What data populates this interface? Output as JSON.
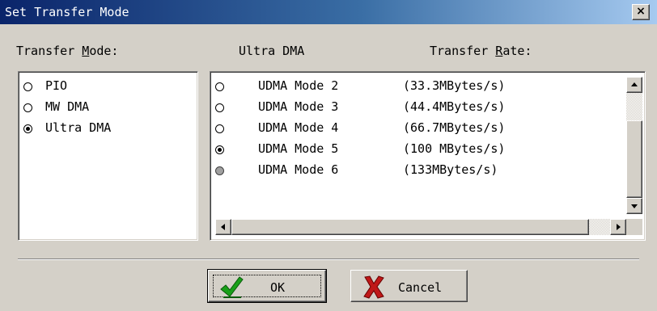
{
  "window": {
    "title": "Set Transfer Mode",
    "close_glyph": "×"
  },
  "labels": {
    "transfer_mode": "Transfer Mode:",
    "transfer_mode_prefix": "Transfer ",
    "transfer_mode_accel": "M",
    "transfer_mode_rest": "ode:",
    "ultra_dma": "Ultra DMA",
    "transfer_rate_prefix": "Transfer ",
    "transfer_rate_accel": "R",
    "transfer_rate_rest": "ate:"
  },
  "transfer_modes": [
    {
      "label": "PIO",
      "selected": false
    },
    {
      "label": "MW DMA",
      "selected": false
    },
    {
      "label": "Ultra DMA",
      "selected": true
    }
  ],
  "udma_modes": [
    {
      "label": "UDMA Mode 2",
      "rate": "(33.3MBytes/s)",
      "selected": false,
      "enabled": true
    },
    {
      "label": "UDMA Mode 3",
      "rate": "(44.4MBytes/s)",
      "selected": false,
      "enabled": true
    },
    {
      "label": "UDMA Mode 4",
      "rate": "(66.7MBytes/s)",
      "selected": false,
      "enabled": true
    },
    {
      "label": "UDMA Mode 5",
      "rate": "(100 MBytes/s)",
      "selected": true,
      "enabled": true
    },
    {
      "label": "UDMA Mode 6",
      "rate": "(133MBytes/s)",
      "selected": false,
      "enabled": false
    }
  ],
  "buttons": {
    "ok": "OK",
    "cancel": "Cancel"
  },
  "colors": {
    "title_bar_start": "#0a246a",
    "title_bar_end": "#a6caf0",
    "dialog_face": "#d4d0c8",
    "ok_check": "#19a019",
    "cancel_x": "#c01818"
  },
  "icons": {
    "ok": "green-checkmark-icon",
    "cancel": "red-x-icon",
    "close": "close-icon"
  }
}
